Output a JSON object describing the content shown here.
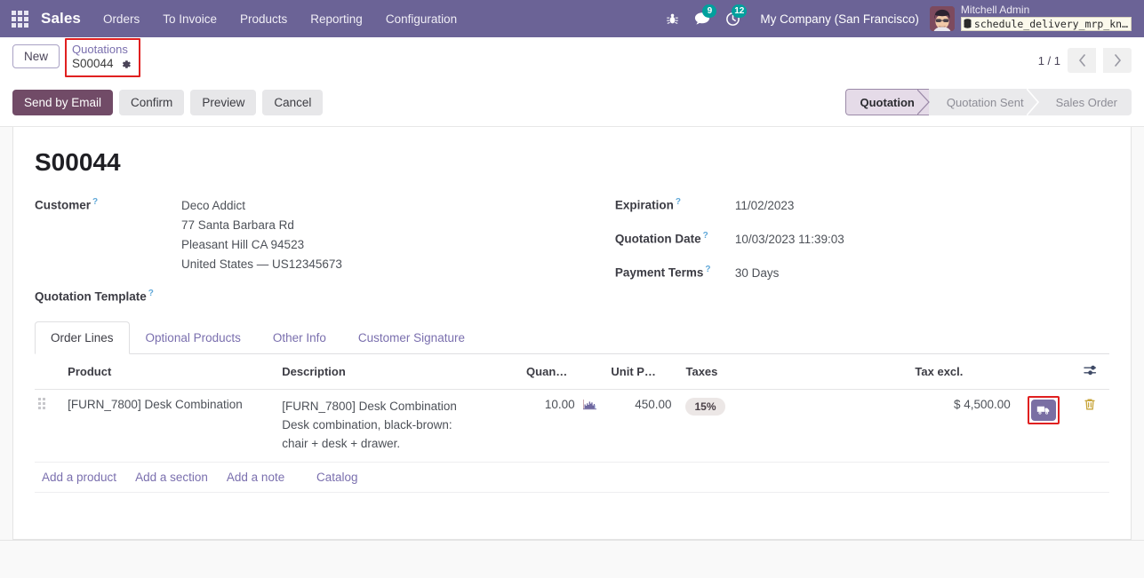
{
  "navbar": {
    "apps_icon": "apps-grid-icon",
    "brand": "Sales",
    "menus": [
      "Orders",
      "To Invoice",
      "Products",
      "Reporting",
      "Configuration"
    ],
    "sys_icons": [
      {
        "name": "bug-icon",
        "glyph": "☣"
      },
      {
        "name": "messages-icon",
        "glyph": "ὊC",
        "badge": "9"
      },
      {
        "name": "activities-clock-icon",
        "glyph": "◷",
        "badge": "12"
      }
    ],
    "messages_badge": "9",
    "activities_badge": "12",
    "company": "My Company (San Francisco)",
    "user_name": "Mitchell Admin",
    "database": "schedule_delivery_mrp_kn…"
  },
  "control_panel": {
    "new_button": "New",
    "breadcrumb_parent": "Quotations",
    "breadcrumb_current": "S00044",
    "pager": "1 / 1",
    "buttons": [
      {
        "label": "Send by Email",
        "style": "primary"
      },
      {
        "label": "Confirm",
        "style": "secondary"
      },
      {
        "label": "Preview",
        "style": "secondary"
      },
      {
        "label": "Cancel",
        "style": "secondary"
      }
    ],
    "status_steps": [
      {
        "label": "Quotation",
        "active": true
      },
      {
        "label": "Quotation Sent",
        "active": false
      },
      {
        "label": "Sales Order",
        "active": false
      }
    ]
  },
  "record": {
    "title": "S00044",
    "left_fields": [
      {
        "label": "Customer",
        "value": "Deco Addict",
        "extra_lines": [
          "77 Santa Barbara Rd",
          "Pleasant Hill CA 94523",
          "United States — US12345673"
        ]
      },
      {
        "label": "Quotation Template",
        "value": ""
      }
    ],
    "right_fields": [
      {
        "label": "Expiration",
        "value": "11/02/2023"
      },
      {
        "label": "Quotation Date",
        "value": "10/03/2023 11:39:03"
      },
      {
        "label": "Payment Terms",
        "value": "30 Days"
      }
    ]
  },
  "notebook": {
    "tabs": [
      {
        "label": "Order Lines",
        "active": true
      },
      {
        "label": "Optional Products",
        "active": false
      },
      {
        "label": "Other Info",
        "active": false
      },
      {
        "label": "Customer Signature",
        "active": false
      }
    ]
  },
  "order_lines": {
    "headers": [
      "Product",
      "Description",
      "Quan…",
      "Unit P…",
      "Taxes",
      "Tax excl."
    ],
    "optional_columns_icon": "column-options-icon",
    "rows": [
      {
        "product": "[FURN_7800] Desk Combination",
        "description": [
          "[FURN_7800] Desk Combination",
          "Desk combination, black-brown:",
          "chair + desk + drawer."
        ],
        "quantity": "10.00",
        "forecast_icon": "forecast-chart-icon",
        "unit_price": "450.00",
        "taxes": "15%",
        "tax_excl": "$ 4,500.00",
        "delivery_icon": "delivery-truck-icon",
        "delete_icon": "trash-icon"
      }
    ],
    "footer_links": [
      "Add a product",
      "Add a section",
      "Add a note",
      "Catalog"
    ]
  },
  "colors": {
    "navbar": "#6b6396",
    "primary": "#714b67",
    "link": "#7a6fae",
    "badge_green": "#00a09d",
    "highlight_box": "#e02020",
    "truck_button": "#7a6fa3"
  }
}
